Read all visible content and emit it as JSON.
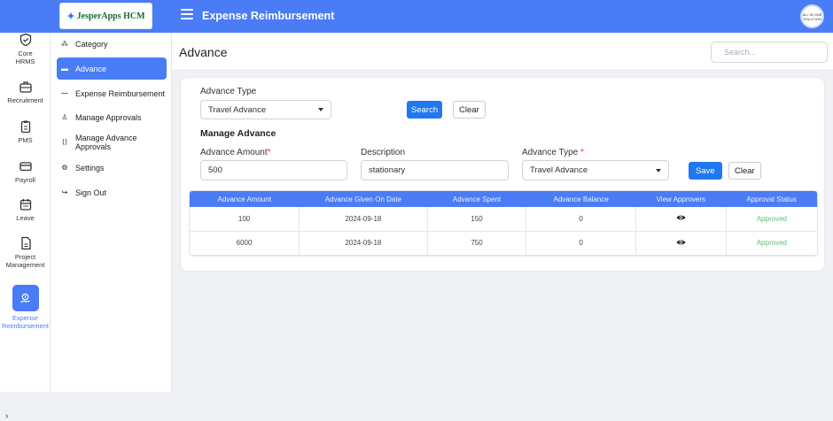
{
  "header": {
    "logo_text": "JesperApps HCM",
    "app_title": "Expense Reimbursement",
    "avatar_text": "ALL IN ONE SOLUTION"
  },
  "rail": {
    "items": [
      {
        "label": "Core HRMS",
        "icon": "shield-check-icon"
      },
      {
        "label": "Recruitment",
        "icon": "briefcase-icon"
      },
      {
        "label": "PMS",
        "icon": "clipboard-icon"
      },
      {
        "label": "Payroll",
        "icon": "credit-card-icon"
      },
      {
        "label": "Leave",
        "icon": "calendar-icon"
      },
      {
        "label": "Project Management",
        "icon": "document-icon"
      },
      {
        "label": "Expense Reimbursement",
        "icon": "expense-icon"
      }
    ],
    "collapse_glyph": "›"
  },
  "subnav": {
    "items": [
      {
        "label": "Category",
        "icon": "category-icon"
      },
      {
        "label": "Advance",
        "icon": "wallet-icon"
      },
      {
        "label": "Expense Reimbursement",
        "icon": "reimburse-icon"
      },
      {
        "label": "Manage Approvals",
        "icon": "user-icon"
      },
      {
        "label": "Manage Advance Approvals",
        "icon": "code-icon"
      },
      {
        "label": "Settings",
        "icon": "gear-icon"
      },
      {
        "label": "Sign Out",
        "icon": "sign-out-icon"
      }
    ],
    "active_index": 1
  },
  "page": {
    "title": "Advance",
    "search_placeholder": "Search..."
  },
  "filter": {
    "advance_type_label": "Advance Type",
    "advance_type_value": "Travel Advance",
    "search_button": "Search",
    "clear_button": "Clear"
  },
  "form": {
    "section_title": "Manage Advance",
    "amount_label": "Advance Amount",
    "amount_value": "500",
    "description_label": "Description",
    "description_value": "stationary",
    "type_label": "Advance Type",
    "type_value": "Travel Advance",
    "required_mark": "*",
    "save_button": "Save",
    "clear_button": "Clear"
  },
  "table": {
    "headers": [
      "Advance Amount",
      "Advance Given On Date",
      "Advance Spent",
      "Advance Balance",
      "View Approvers",
      "Approval Status"
    ],
    "rows": [
      {
        "amount": "100",
        "date": "2024-09-18",
        "spent": "150",
        "balance": "0",
        "status": "Approved"
      },
      {
        "amount": "6000",
        "date": "2024-09-18",
        "spent": "750",
        "balance": "0",
        "status": "Approved"
      }
    ]
  },
  "colors": {
    "primary": "#4a7cf6",
    "button_primary": "#1f78f0",
    "approved": "#5ec07a"
  }
}
